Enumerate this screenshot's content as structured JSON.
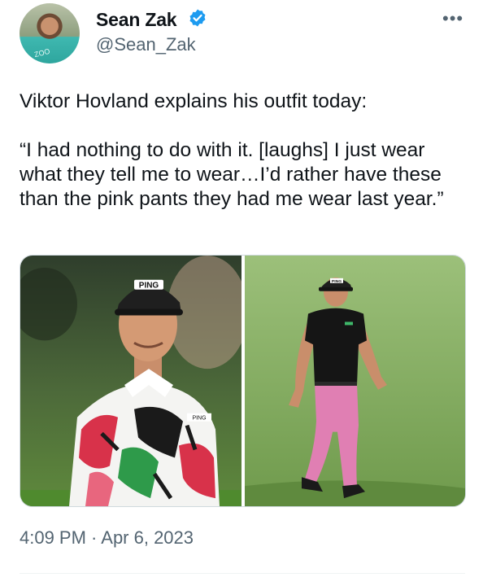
{
  "author": {
    "display_name": "Sean Zak",
    "handle": "@Sean_Zak",
    "avatar_shirt_text": "ZOO",
    "verified": true
  },
  "icons": {
    "verified": "verified-badge-icon",
    "more": "more-options-icon"
  },
  "more_glyph": "•••",
  "tweet": {
    "text": "Viktor Hovland explains his outfit today:\n\n“I had nothing to do with it. [laughs] I just wear what they tell me to wear…I’d rather have these than the pink pants they had me wear last year.”",
    "timestamp": "4:09 PM · Apr 6, 2023"
  },
  "media": {
    "photo_left": {
      "cap_logo": "PING",
      "sleeve_logo": "PING"
    },
    "photo_right": {
      "cap_logo": "PING"
    }
  },
  "colors": {
    "verified_blue": "#1d9bf0",
    "text_primary": "#0f1419",
    "text_secondary": "#536471",
    "pants_pink": "#e07fb3",
    "shirt_red": "#d8324a",
    "fairway_green": "#7fa65a"
  }
}
